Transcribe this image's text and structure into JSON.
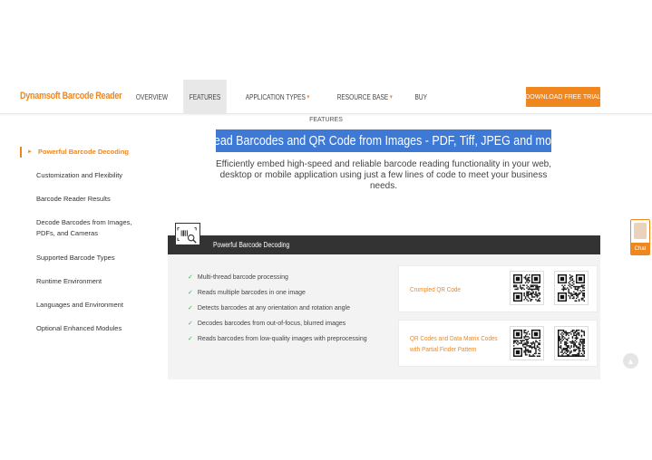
{
  "colors": {
    "accent": "#f0871e",
    "dark_bar": "#333333",
    "highlight": "#3e79d6",
    "check": "#3fae5a"
  },
  "header": {
    "logo": "Dynamsoft Barcode Reader",
    "nav": [
      {
        "label": "OVERVIEW",
        "caret": ""
      },
      {
        "label": "FEATURES",
        "caret": ""
      },
      {
        "label": "APPLICATION TYPES",
        "caret": "▾"
      },
      {
        "label": "RESOURCE BASE",
        "caret": "▾"
      },
      {
        "label": "BUY",
        "caret": ""
      }
    ],
    "active_nav": "FEATURES",
    "cta": "DOWNLOAD FREE TRIAL"
  },
  "hero": {
    "eyebrow": "FEATURES",
    "title": "Read Barcodes and QR Code from Images - PDF, Tiff, JPEG and more",
    "intro": "Efficiently embed high-speed and reliable barcode reading functionality in your web, desktop or mobile application using just a few lines of code to meet your business needs."
  },
  "sidebar": {
    "items": [
      {
        "label": "Powerful Barcode Decoding",
        "active": true
      },
      {
        "label": "Customization and Flexibility"
      },
      {
        "label": "Barcode Reader Results"
      },
      {
        "label": "Decode Barcodes from Images, PDFs, and Cameras"
      },
      {
        "label": "Supported Barcode Types"
      },
      {
        "label": "Runtime Environment"
      },
      {
        "label": "Languages and Environment"
      },
      {
        "label": "Optional Enhanced Modules"
      }
    ],
    "arrow": "►"
  },
  "feature": {
    "icon": "barcode-search-icon",
    "title": "Powerful Barcode Decoding",
    "bullets": [
      "Multi-thread barcode processing",
      "Reads multiple barcodes in one image",
      "Detects barcodes at any orientation and rotation angle",
      "Decodes barcodes from out-of-focus, blurred images",
      "Reads barcodes from low-quality images with preprocessing"
    ],
    "check_glyph": "✓",
    "cards": [
      {
        "label_lines": [
          "Crumpled QR Code"
        ]
      },
      {
        "label_lines": [
          "QR Codes and Data Matrix Codes",
          "with Partial Finder Pattern"
        ]
      }
    ]
  },
  "chat": {
    "label": "Chat"
  },
  "to_top": {
    "glyph": "▲"
  }
}
